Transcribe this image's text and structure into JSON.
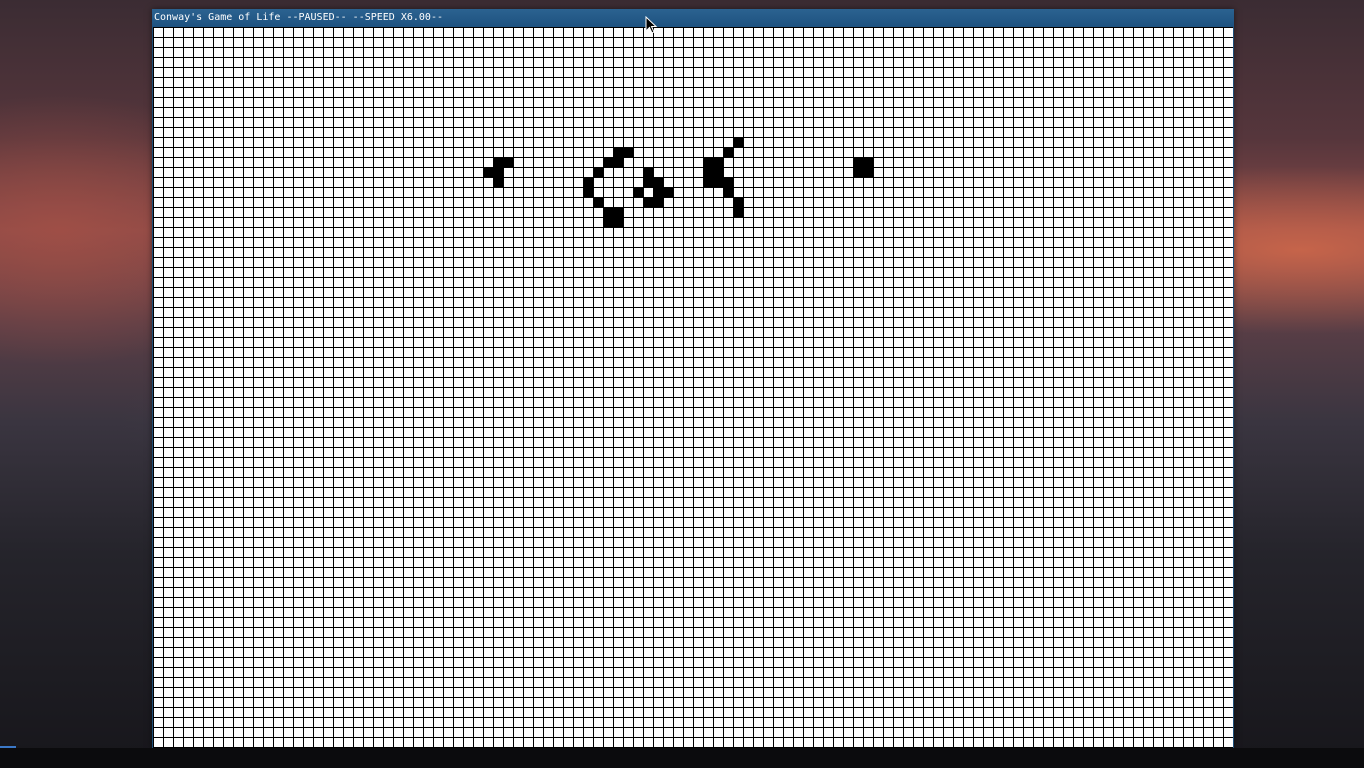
{
  "window": {
    "title": "Conway's Game of Life --PAUSED-- --SPEED X6.00--"
  },
  "game": {
    "state": "PAUSED",
    "speed": "X6.00",
    "grid_line_color": "#000000",
    "cell_dead_color": "#ffffff",
    "cell_alive_color": "#000000",
    "alive_cells": [
      [
        58,
        11
      ],
      [
        46,
        12
      ],
      [
        47,
        12
      ],
      [
        57,
        12
      ],
      [
        34,
        13
      ],
      [
        35,
        13
      ],
      [
        45,
        13
      ],
      [
        46,
        13
      ],
      [
        55,
        13
      ],
      [
        56,
        13
      ],
      [
        70,
        13
      ],
      [
        71,
        13
      ],
      [
        33,
        14
      ],
      [
        34,
        14
      ],
      [
        44,
        14
      ],
      [
        49,
        14
      ],
      [
        55,
        14
      ],
      [
        56,
        14
      ],
      [
        70,
        14
      ],
      [
        71,
        14
      ],
      [
        34,
        15
      ],
      [
        43,
        15
      ],
      [
        49,
        15
      ],
      [
        50,
        15
      ],
      [
        55,
        15
      ],
      [
        56,
        15
      ],
      [
        57,
        15
      ],
      [
        43,
        16
      ],
      [
        48,
        16
      ],
      [
        50,
        16
      ],
      [
        51,
        16
      ],
      [
        57,
        16
      ],
      [
        44,
        17
      ],
      [
        49,
        17
      ],
      [
        50,
        17
      ],
      [
        58,
        17
      ],
      [
        45,
        18
      ],
      [
        46,
        18
      ],
      [
        58,
        18
      ],
      [
        45,
        19
      ],
      [
        46,
        19
      ]
    ]
  },
  "colors": {
    "titlebar": "#1e5280",
    "title_text": "#ffffff"
  }
}
